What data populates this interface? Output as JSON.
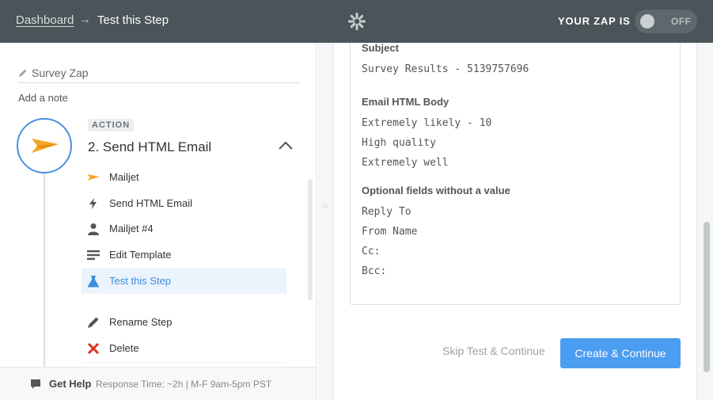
{
  "header": {
    "breadcrumb_link": "Dashboard",
    "breadcrumb_separator": "→",
    "breadcrumb_current": "Test this Step",
    "zap_status_label": "YOUR ZAP IS",
    "toggle_state": "OFF"
  },
  "sidebar": {
    "zap_name": "Survey Zap",
    "add_note": "Add a note",
    "step": {
      "badge": "ACTION",
      "title": "2. Send HTML Email"
    },
    "menu": [
      {
        "label": "Mailjet",
        "icon": "mailjet-icon"
      },
      {
        "label": "Send HTML Email",
        "icon": "bolt-icon"
      },
      {
        "label": "Mailjet #4",
        "icon": "user-icon"
      },
      {
        "label": "Edit Template",
        "icon": "template-lines-icon"
      },
      {
        "label": "Test this Step",
        "icon": "flask-icon",
        "active": true
      },
      {
        "label": "Rename Step",
        "icon": "pencil-icon"
      },
      {
        "label": "Delete",
        "icon": "delete-x-icon"
      }
    ],
    "help": {
      "label": "Get Help",
      "meta": "Response Time: ~2h | M-F 9am-5pm PST"
    }
  },
  "main": {
    "fields": [
      {
        "label": "Subject",
        "values": [
          "Survey Results - 5139757696"
        ]
      },
      {
        "label": "Email HTML Body",
        "values": [
          "Extremely likely - 10",
          "High quality",
          "Extremely well"
        ]
      },
      {
        "label": "Optional fields without a value",
        "values": [
          "Reply To",
          "From Name",
          "Cc:",
          "Bcc:"
        ]
      }
    ],
    "skip_label": "Skip Test & Continue",
    "create_label": "Create & Continue"
  },
  "colors": {
    "header_bg": "#4a5459",
    "accent": "#4a9df0",
    "active_bg": "#ebf3fc",
    "mailjet_orange": "#f5a623",
    "delete_red": "#e0301e"
  }
}
